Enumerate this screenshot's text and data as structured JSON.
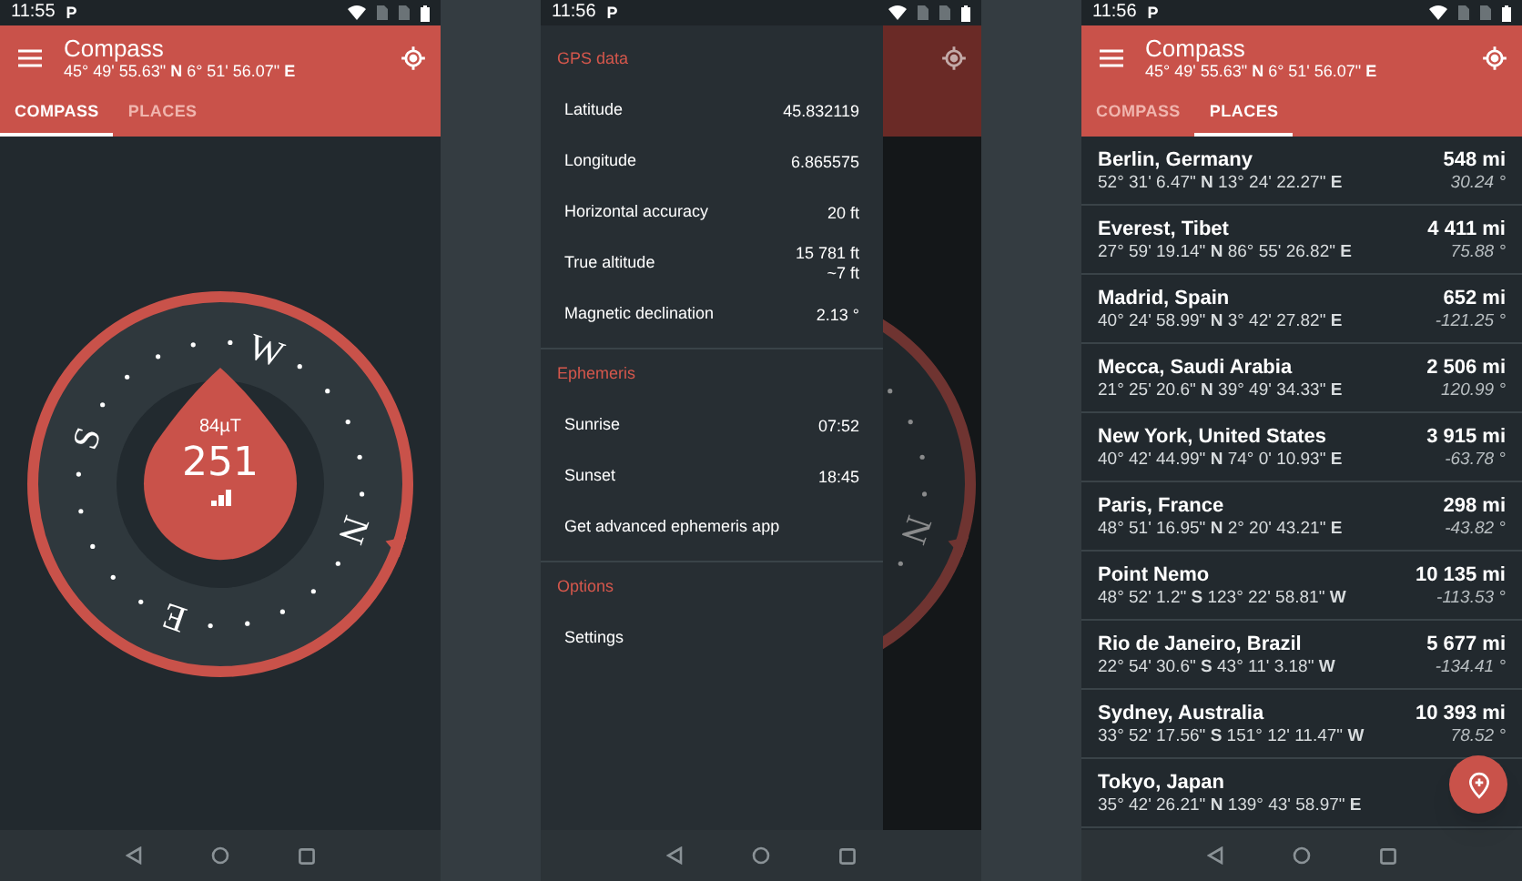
{
  "screens": [
    {
      "kind": "compass",
      "status_bar": {
        "time": "11:55",
        "notification": "P"
      },
      "app_bar": {
        "title": "Compass",
        "subtitle": "45° 49' 55.63\" **N** 6° 51' 56.07\" **E**"
      },
      "tabs": [
        {
          "label": "COMPASS",
          "selected": true
        },
        {
          "label": "PLACES",
          "selected": false
        }
      ],
      "compass": {
        "field": "84µT",
        "heading": "251",
        "letters": [
          "N",
          "E",
          "S",
          "W"
        ]
      }
    },
    {
      "kind": "drawer",
      "status_bar": {
        "time": "11:56",
        "notification": "P"
      },
      "sections": [
        {
          "header": "GPS data",
          "rows": [
            {
              "label": "Latitude",
              "values": [
                "45.832119"
              ]
            },
            {
              "label": "Longitude",
              "values": [
                "6.865575"
              ]
            },
            {
              "label": "Horizontal accuracy",
              "values": [
                "20 ft"
              ]
            },
            {
              "label": "True altitude",
              "values": [
                "15 781 ft",
                "~7 ft"
              ]
            },
            {
              "label": "Magnetic declination",
              "values": [
                "2.13 °"
              ]
            }
          ]
        },
        {
          "header": "Ephemeris",
          "rows": [
            {
              "label": "Sunrise",
              "values": [
                "07:52"
              ]
            },
            {
              "label": "Sunset",
              "values": [
                "18:45"
              ]
            },
            {
              "label": "Get advanced ephemeris app"
            }
          ]
        },
        {
          "header": "Options",
          "rows": [
            {
              "label": "Settings"
            }
          ]
        }
      ],
      "behind": {
        "letter": "N"
      }
    },
    {
      "kind": "places",
      "status_bar": {
        "time": "11:56",
        "notification": "P"
      },
      "app_bar": {
        "title": "Compass",
        "subtitle": "45° 49' 55.63\" **N** 6° 51' 56.07\" **E**"
      },
      "tabs": [
        {
          "label": "COMPASS",
          "selected": false
        },
        {
          "label": "PLACES",
          "selected": true
        }
      ],
      "places": [
        {
          "name": "Berlin, Germany",
          "coords": "52° 31' 6.47\" **N** 13° 24' 22.27\" **E**",
          "distance": "548 mi",
          "bearing": "30.24 °"
        },
        {
          "name": "Everest, Tibet",
          "coords": "27° 59' 19.14\" **N** 86° 55' 26.82\" **E**",
          "distance": "4 411 mi",
          "bearing": "75.88 °"
        },
        {
          "name": "Madrid, Spain",
          "coords": "40° 24' 58.99\" **N** 3° 42' 27.82\" **E**",
          "distance": "652 mi",
          "bearing": "-121.25 °"
        },
        {
          "name": "Mecca, Saudi Arabia",
          "coords": "21° 25' 20.6\" **N** 39° 49' 34.33\" **E**",
          "distance": "2 506 mi",
          "bearing": "120.99 °"
        },
        {
          "name": "New York, United States",
          "coords": "40° 42' 44.99\" **N** 74° 0' 10.93\" **E**",
          "distance": "3 915 mi",
          "bearing": "-63.78 °"
        },
        {
          "name": "Paris, France",
          "coords": "48° 51' 16.95\" **N** 2° 20' 43.21\" **E**",
          "distance": "298 mi",
          "bearing": "-43.82 °"
        },
        {
          "name": "Point Nemo",
          "coords": "48° 52' 1.2\" **S** 123° 22' 58.81\" **W**",
          "distance": "10 135 mi",
          "bearing": "-113.53 °"
        },
        {
          "name": "Rio de Janeiro, Brazil",
          "coords": "22° 54' 30.6\" **S** 43° 11' 3.18\" **W**",
          "distance": "5 677 mi",
          "bearing": "-134.41 °"
        },
        {
          "name": "Sydney, Australia",
          "coords": "33° 52' 17.56\" **S** 151° 12' 11.47\" **W**",
          "distance": "10 393 mi",
          "bearing": "78.52 °"
        },
        {
          "name": "Tokyo, Japan",
          "coords": "35° 42' 26.21\" **N** 139° 43' 58.97\" **E**"
        }
      ]
    }
  ]
}
